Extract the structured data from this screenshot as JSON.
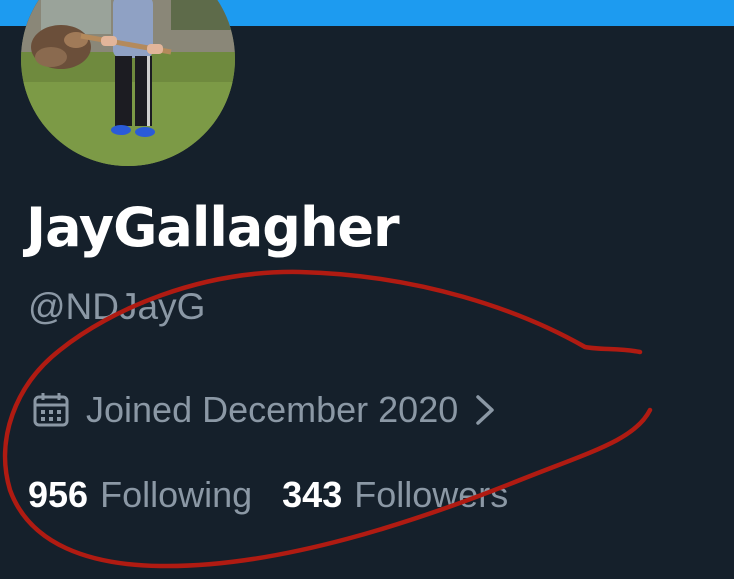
{
  "colors": {
    "background": "#15202b",
    "banner": "#1d9bf0",
    "primary_text": "#ffffff",
    "secondary_text": "#8b98a5",
    "annotation_circle": "#b01b12"
  },
  "profile": {
    "display_name": "JayGallagher",
    "handle": "@NDJayG",
    "avatar_icon": "profile-photo",
    "joined": {
      "icon": "calendar-icon",
      "label": "Joined December 2020",
      "chevron_icon": "chevron-right-icon"
    },
    "stats": [
      {
        "count": "956",
        "label": "Following"
      },
      {
        "count": "343",
        "label": "Followers"
      }
    ]
  }
}
